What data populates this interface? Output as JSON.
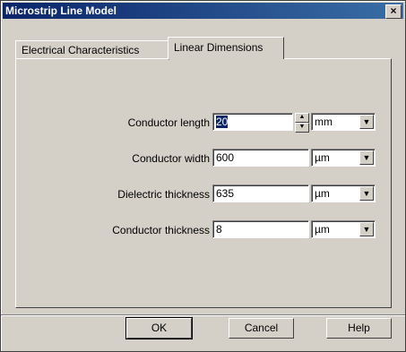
{
  "window": {
    "title": "Microstrip Line Model"
  },
  "tabs": [
    {
      "label": "Electrical Characteristics"
    },
    {
      "label": "Linear Dimensions"
    }
  ],
  "fields": [
    {
      "label": "Conductor length",
      "value": "20",
      "unit": "mm"
    },
    {
      "label": "Conductor width",
      "value": "600",
      "unit": "µm"
    },
    {
      "label": "Dielectric thickness",
      "value": "635",
      "unit": "µm"
    },
    {
      "label": "Conductor thickness",
      "value": "8",
      "unit": "µm"
    }
  ],
  "buttons": {
    "ok": "OK",
    "cancel": "Cancel",
    "help": "Help"
  },
  "icons": {
    "close": "×",
    "spin_up": "▲",
    "spin_down": "▼",
    "dropdown": "▼"
  }
}
